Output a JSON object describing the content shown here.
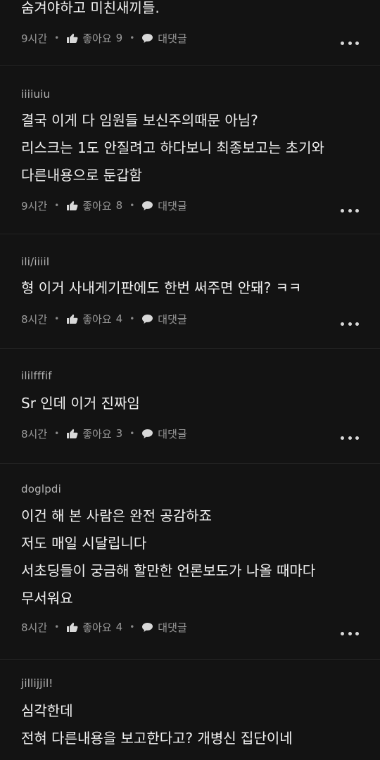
{
  "comments": [
    {
      "username": "",
      "lines": [
        "숨겨야하고 미친새끼들."
      ],
      "time": "9시간",
      "like_label": "좋아요",
      "like_count": "9",
      "reply_label": "대댓글"
    },
    {
      "username": "iiiiuiu",
      "lines": [
        "결국 이게 다 임원들 보신주의때문 아님?",
        "리스크는 1도 안질려고 하다보니 최종보고는 초기와",
        "다른내용으로 둔갑함"
      ],
      "time": "9시간",
      "like_label": "좋아요",
      "like_count": "8",
      "reply_label": "대댓글"
    },
    {
      "username": "ili/iiiil",
      "lines": [
        "형 이거 사내게기판에도 한번 써주면 안돼? ㅋㅋ"
      ],
      "time": "8시간",
      "like_label": "좋아요",
      "like_count": "4",
      "reply_label": "대댓글"
    },
    {
      "username": "ililfffif",
      "lines": [
        "Sr 인데 이거 진짜임"
      ],
      "time": "8시간",
      "like_label": "좋아요",
      "like_count": "3",
      "reply_label": "대댓글"
    },
    {
      "username": "doglpdi",
      "lines": [
        "이건 해 본 사람은 완전 공감하죠",
        "저도 매일 시달립니다",
        "서초딩들이 궁금해 할만한 언론보도가 나올 때마다",
        "무서워요"
      ],
      "time": "8시간",
      "like_label": "좋아요",
      "like_count": "4",
      "reply_label": "대댓글"
    },
    {
      "username": "jillijjil!",
      "lines": [
        "심각한데",
        "전혀 다른내용을 보고한다고? 개병신 집단이네"
      ]
    }
  ],
  "icons": {
    "like": "thumbs-up-icon",
    "reply": "speech-bubble-icon",
    "more": "more-dots-icon"
  },
  "colors": {
    "background": "#131313",
    "text": "#f0f0f0",
    "meta": "#9a9a9a"
  }
}
